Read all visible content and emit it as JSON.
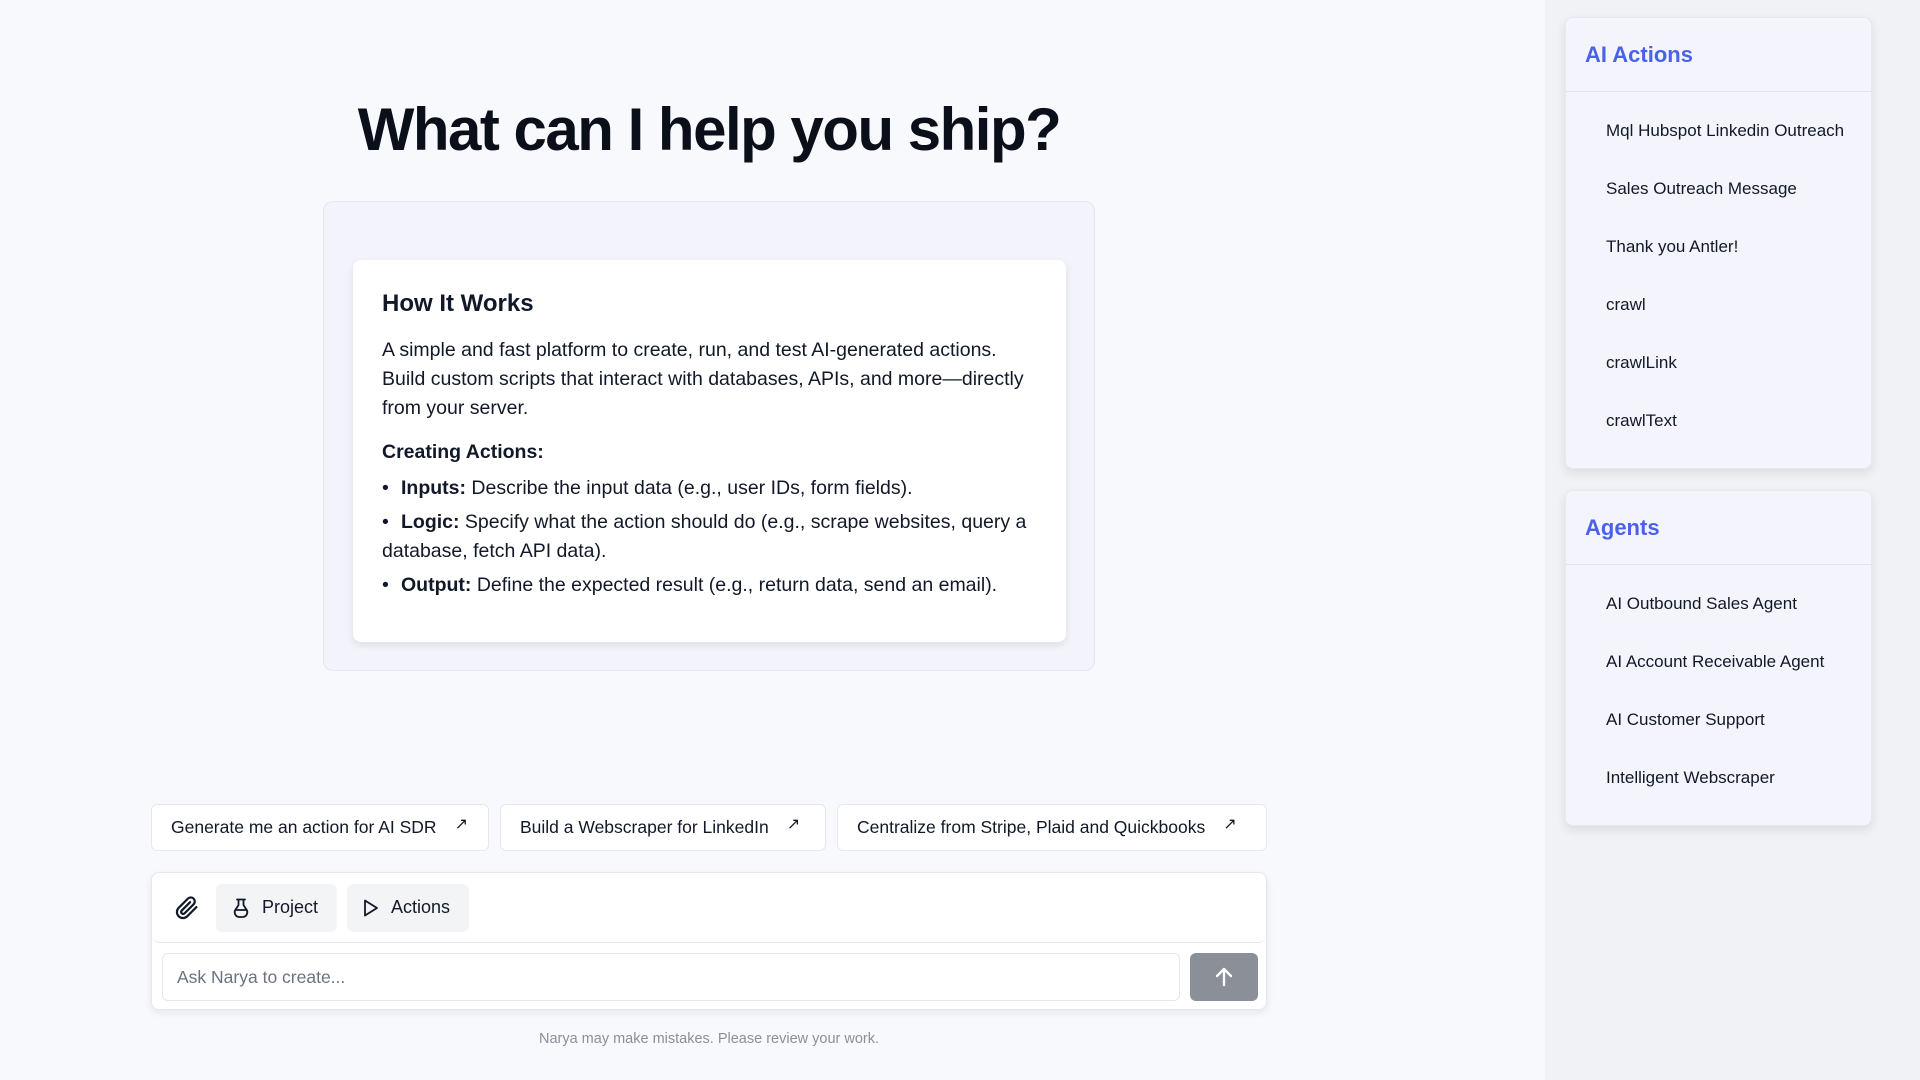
{
  "main": {
    "heading": "What can I help you ship?",
    "how_it_works": {
      "title": "How It Works",
      "description": "A simple and fast platform to create, run, and test AI-generated actions. Build custom scripts that interact with databases, APIs, and more—directly from your server.",
      "subtitle": "Creating Actions:",
      "items": [
        {
          "label": "Inputs:",
          "text": "Describe the input data (e.g., user IDs, form fields)."
        },
        {
          "label": "Logic:",
          "text": "Specify what the action should do (e.g., scrape websites, query a database, fetch API data)."
        },
        {
          "label": "Output:",
          "text": "Define the expected result (e.g., return data, send an email)."
        }
      ]
    },
    "suggestions": [
      {
        "label": "Generate me an action for AI SDR",
        "icon": "arrow-up-right-icon"
      },
      {
        "label": "Build a Webscraper for LinkedIn",
        "icon": "arrow-up-right-icon"
      },
      {
        "label": "Centralize from Stripe, Plaid and Quickbooks",
        "icon": "arrow-up-right-icon"
      }
    ],
    "composer": {
      "attach_icon": "paperclip-icon",
      "project_label": "Project",
      "project_icon": "flask-icon",
      "actions_label": "Actions",
      "actions_icon": "play-icon",
      "input_placeholder": "Ask Narya to create...",
      "input_value": "",
      "send_icon": "arrow-up-icon"
    },
    "disclaimer": "Narya may make mistakes. Please review your work."
  },
  "sidebar": {
    "ai_actions": {
      "title": "AI Actions",
      "items": [
        "Mql Hubspot Linkedin Outreach",
        "Sales Outreach Message",
        "Thank you Antler!",
        "crawl",
        "crawlLink",
        "crawlText"
      ]
    },
    "agents": {
      "title": "Agents",
      "items": [
        "AI Outbound Sales Agent",
        "AI Account Receivable Agent",
        "AI Customer Support",
        "Intelligent Webscraper"
      ]
    }
  },
  "colors": {
    "accent": "#4a62e8",
    "send_button": "#8b8f98",
    "background": "#f8f9fc",
    "sidebar_background": "#f1f2f5"
  }
}
